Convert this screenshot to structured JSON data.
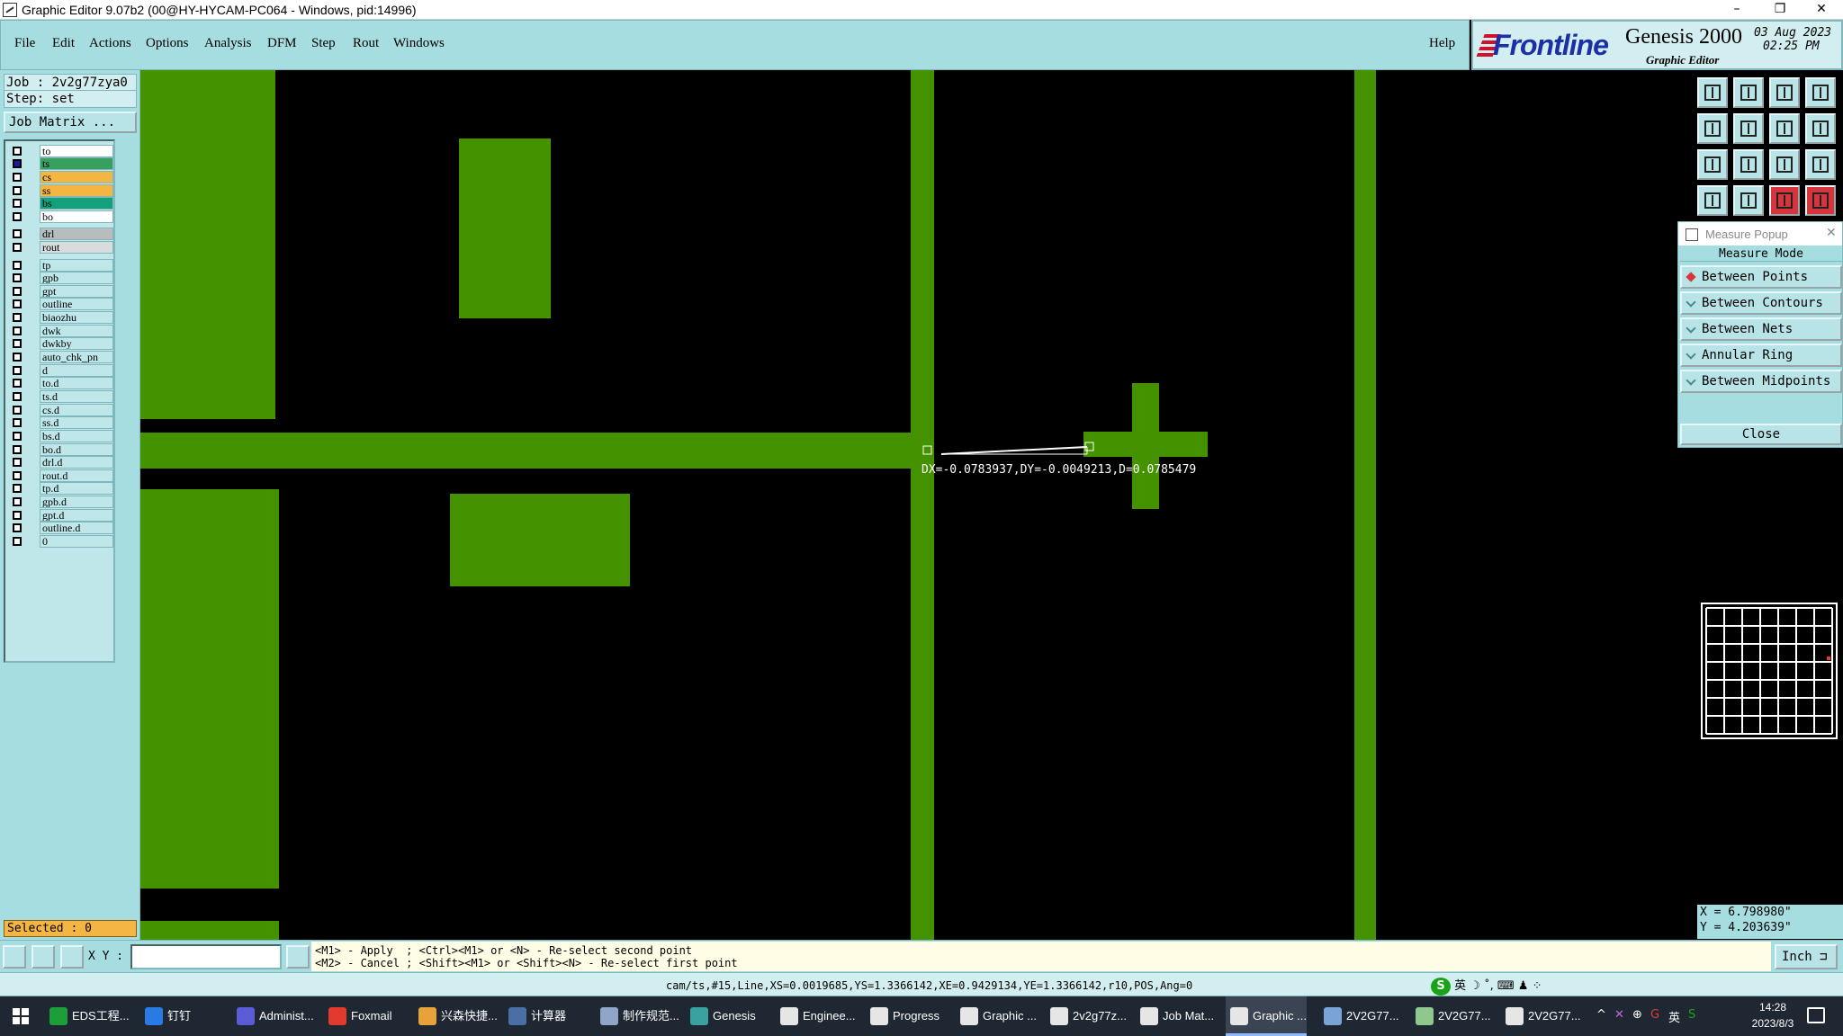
{
  "window": {
    "title": "Graphic Editor 9.07b2 (00@HY-HYCAM-PC064 - Windows, pid:14996)",
    "minimize": "–",
    "restore": "❐",
    "close": "✕"
  },
  "menu": {
    "items": [
      "File",
      "Edit",
      "Actions",
      "Options",
      "Analysis",
      "DFM",
      "Step",
      "Rout",
      "Windows"
    ],
    "help": "Help"
  },
  "logo": {
    "brand": "Frontline",
    "product": "Genesis 2000",
    "subtitle": "Graphic Editor",
    "date": "03 Aug 2023",
    "time": "02:25 PM"
  },
  "left": {
    "job": "Job  : 2v2g77zya0",
    "step": "Step: set",
    "job_matrix": "Job Matrix ...",
    "selected": "Selected : 0",
    "layers": [
      {
        "name": "to",
        "color": "#ffffff",
        "on": false
      },
      {
        "name": "ts",
        "color": "#37a060",
        "on": true
      },
      {
        "name": "cs",
        "color": "#f5b542",
        "on": false
      },
      {
        "name": "ss",
        "color": "#f5b542",
        "on": false
      },
      {
        "name": "bs",
        "color": "#13a07a",
        "on": false
      },
      {
        "name": "bo",
        "color": "#ffffff",
        "on": false
      },
      {
        "name": "drl",
        "color": "#b8bcbc",
        "on": false
      },
      {
        "name": "rout",
        "color": "#d8dcdc",
        "on": false
      },
      {
        "name": "tp",
        "color": "#bfe7ea",
        "on": false
      },
      {
        "name": "gpb",
        "color": "#bfe7ea",
        "on": false
      },
      {
        "name": "gpt",
        "color": "#bfe7ea",
        "on": false
      },
      {
        "name": "outline",
        "color": "#bfe7ea",
        "on": false
      },
      {
        "name": "biaozhu",
        "color": "#bfe7ea",
        "on": false
      },
      {
        "name": "dwk",
        "color": "#bfe7ea",
        "on": false
      },
      {
        "name": "dwkby",
        "color": "#bfe7ea",
        "on": false
      },
      {
        "name": "auto_chk_pn",
        "color": "#bfe7ea",
        "on": false
      },
      {
        "name": "d",
        "color": "#bfe7ea",
        "on": false
      },
      {
        "name": "to.d",
        "color": "#bfe7ea",
        "on": false
      },
      {
        "name": "ts.d",
        "color": "#bfe7ea",
        "on": false
      },
      {
        "name": "cs.d",
        "color": "#bfe7ea",
        "on": false
      },
      {
        "name": "ss.d",
        "color": "#bfe7ea",
        "on": false
      },
      {
        "name": "bs.d",
        "color": "#bfe7ea",
        "on": false
      },
      {
        "name": "bo.d",
        "color": "#bfe7ea",
        "on": false
      },
      {
        "name": "drl.d",
        "color": "#bfe7ea",
        "on": false
      },
      {
        "name": "rout.d",
        "color": "#bfe7ea",
        "on": false
      },
      {
        "name": "tp.d",
        "color": "#bfe7ea",
        "on": false
      },
      {
        "name": "gpb.d",
        "color": "#bfe7ea",
        "on": false
      },
      {
        "name": "gpt.d",
        "color": "#bfe7ea",
        "on": false
      },
      {
        "name": "outline.d",
        "color": "#bfe7ea",
        "on": false
      },
      {
        "name": "0",
        "color": "#bfe7ea",
        "on": false
      }
    ]
  },
  "canvas": {
    "measure_readout": "DX=-0.0783937,DY=-0.0049213,D=0.0785479",
    "copper_color": "#449200"
  },
  "popup": {
    "title": "Measure Popup",
    "close_x": "✕",
    "header": "Measure Mode",
    "modes": [
      {
        "label": "Between Points",
        "selected": true
      },
      {
        "label": "Between Contours",
        "selected": false
      },
      {
        "label": "Between Nets",
        "selected": false
      },
      {
        "label": "Annular Ring",
        "selected": false
      },
      {
        "label": "Between Midpoints",
        "selected": false
      }
    ],
    "close": "Close"
  },
  "coords": {
    "x": "X = 6.798980\"",
    "y": "Y = 4.203639\""
  },
  "status": {
    "xy_label": "X Y :",
    "xy_value": "",
    "hint_line1": "<M1> - Apply  ; <Ctrl><M1> or <N> - Re-select second point",
    "hint_line2": "<M2> - Cancel ; <Shift><M1> or <Shift><N> - Re-select first point",
    "unit": "Inch",
    "info": "cam/ts,#15,Line,XS=0.0019685,YS=1.3366142,XE=0.9429134,YE=1.3366142,r10,POS,Ang=0",
    "ime": "英"
  },
  "taskbar": {
    "tasks": [
      {
        "label": "EDS工程...",
        "color": "#1e9e3a"
      },
      {
        "label": "钉钉",
        "color": "#2a7ae4"
      },
      {
        "label": "Administ...",
        "color": "#5b5bd6"
      },
      {
        "label": "Foxmail",
        "color": "#e23a2e"
      },
      {
        "label": "兴森快捷...",
        "color": "#e8a23a"
      },
      {
        "label": "计算器",
        "color": "#4a6fa5"
      },
      {
        "label": "制作规范...",
        "color": "#8fa6c8"
      },
      {
        "label": "Genesis",
        "color": "#3aa0a0"
      },
      {
        "label": "Enginee...",
        "color": "#e6e6e6"
      },
      {
        "label": "Progress",
        "color": "#e6e6e6"
      },
      {
        "label": "Graphic ...",
        "color": "#e6e6e6"
      },
      {
        "label": "2v2g77z...",
        "color": "#e6e6e6"
      },
      {
        "label": "Job Mat...",
        "color": "#e6e6e6"
      },
      {
        "label": "Graphic ...",
        "color": "#e6e6e6"
      },
      {
        "label": "2V2G77...",
        "color": "#7aa4d8"
      },
      {
        "label": "2V2G77...",
        "color": "#8fc88f"
      },
      {
        "label": "2V2G77...",
        "color": "#e6e6e6"
      }
    ],
    "tray_lang": "英",
    "clock_time": "14:28",
    "clock_date": "2023/8/3"
  }
}
